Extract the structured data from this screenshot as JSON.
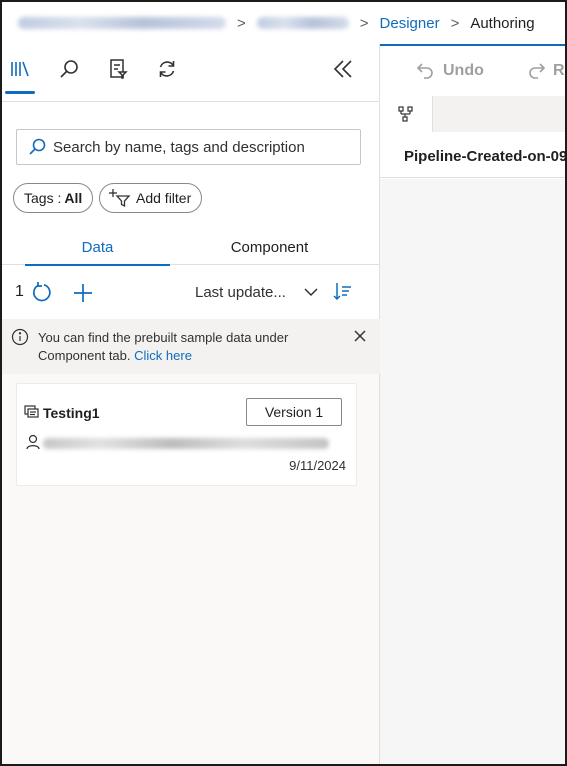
{
  "breadcrumb": {
    "current": "Authoring",
    "parent_link": "Designer",
    "separator": ">"
  },
  "left_panel": {
    "icons": [
      "library-icon",
      "search-icon",
      "filter-list-icon",
      "refresh-icon"
    ],
    "collapse_icon": "double-chevron-left-icon",
    "search": {
      "placeholder": "Search by name, tags and description"
    },
    "tags_filter": {
      "label": "Tags :",
      "value": "All"
    },
    "add_filter_label": "Add filter",
    "tabs": [
      {
        "label": "Data",
        "active": true
      },
      {
        "label": "Component",
        "active": false
      }
    ],
    "toolbar": {
      "count": "1",
      "sort_label": "Last update..."
    },
    "info": {
      "text": "You can find the prebuilt sample data under Component tab.",
      "link": "Click here"
    },
    "items": [
      {
        "title": "Testing1",
        "version_label": "Version 1",
        "date": "9/11/2024"
      }
    ]
  },
  "right_panel": {
    "undo_label": "Undo",
    "redo_label": "Re",
    "pipeline_title": "Pipeline-Created-on-09"
  },
  "colors": {
    "accent": "#0f6cbd",
    "info_bg": "#f3f2f1",
    "border": "#e1dfdd"
  }
}
